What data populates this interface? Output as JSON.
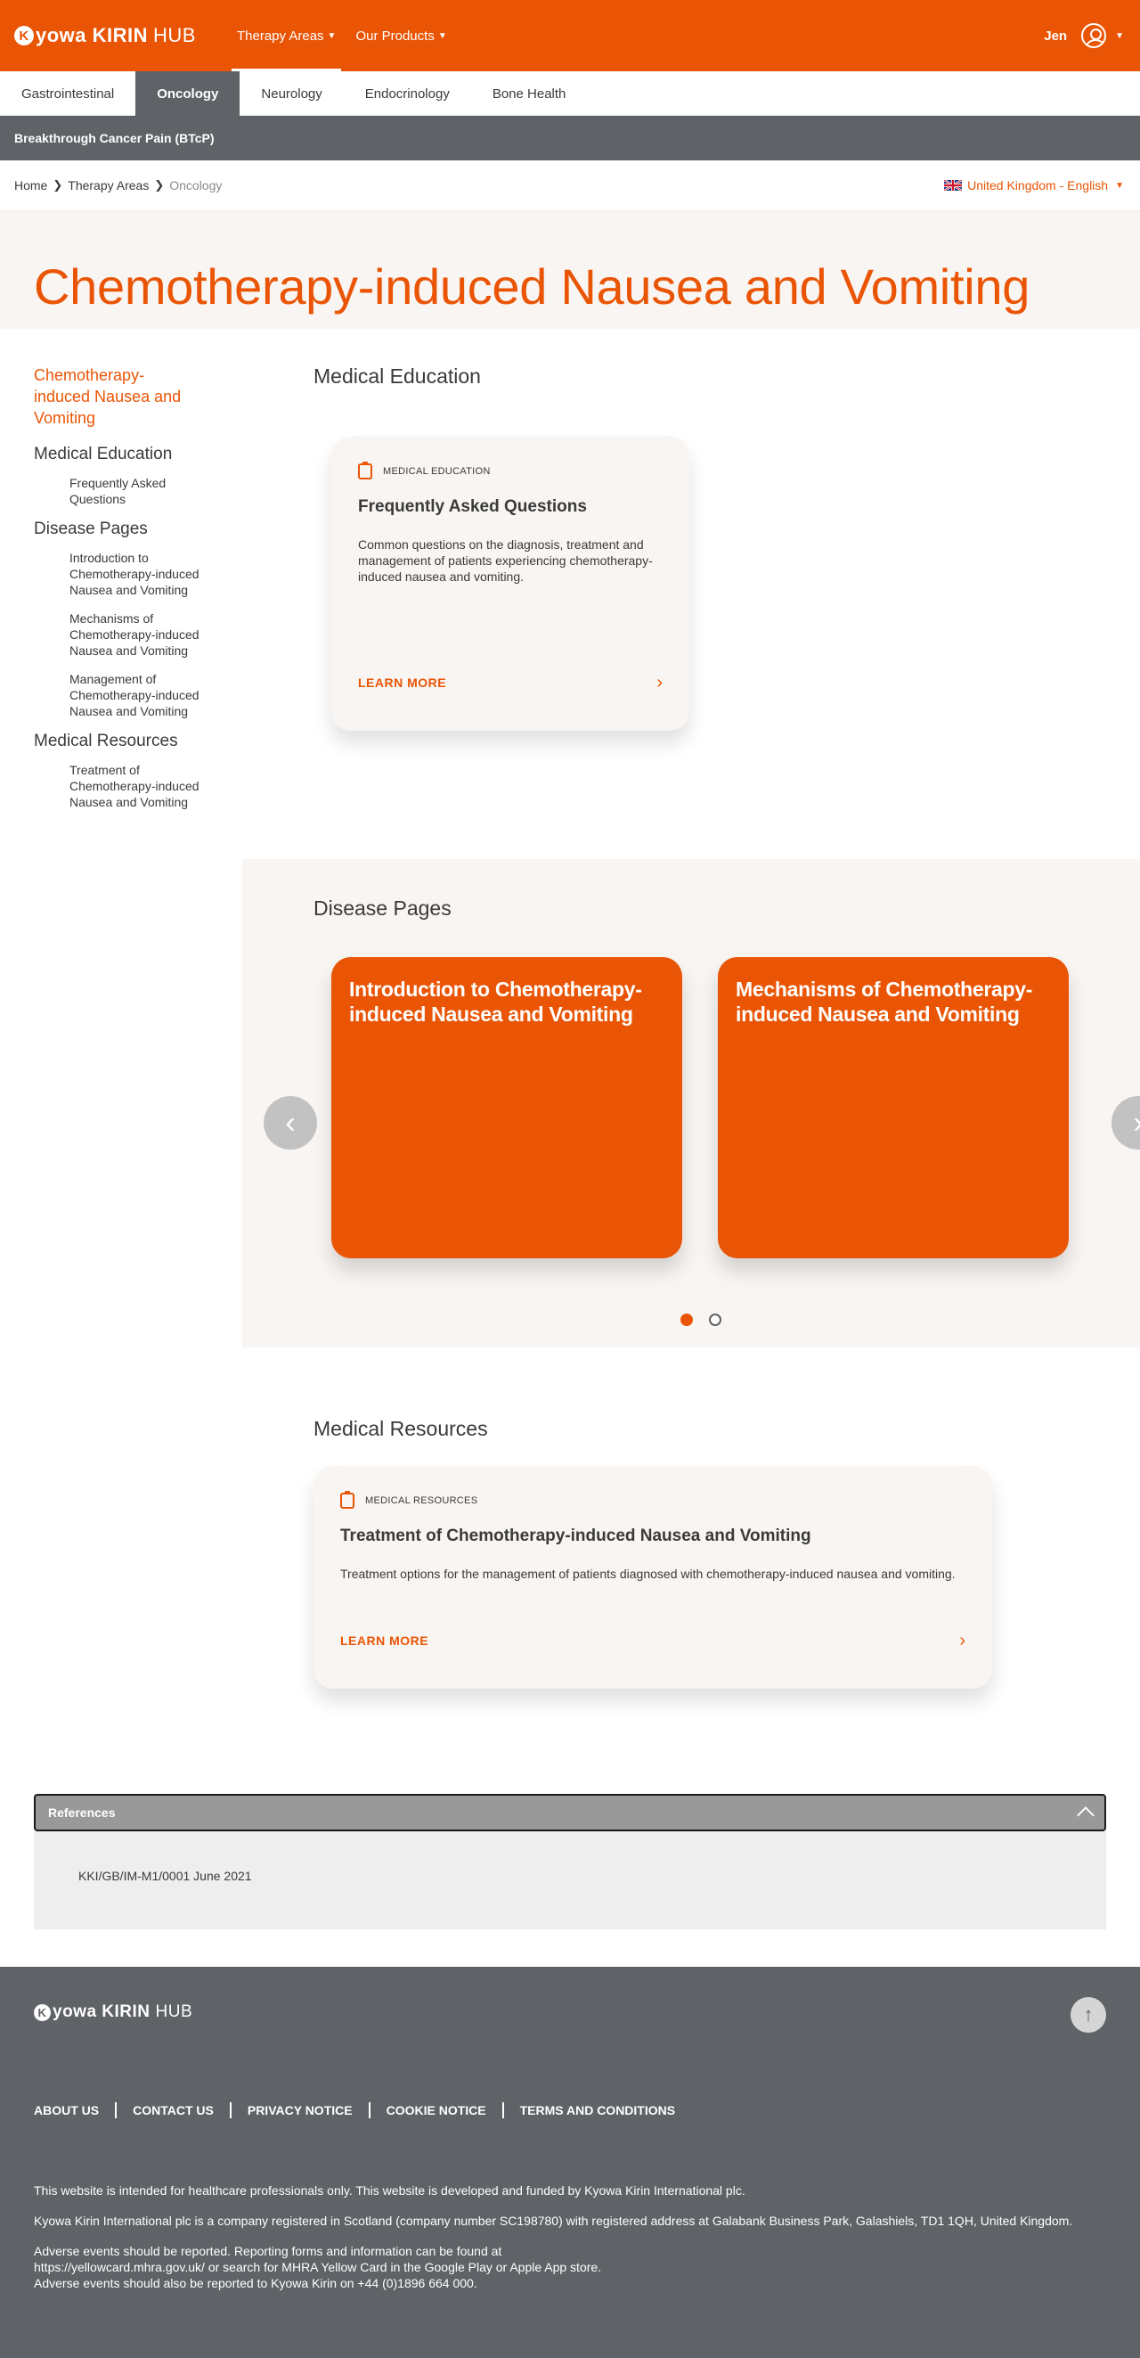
{
  "header": {
    "logo_mark": "K",
    "logo_text": "yowa KIRIN",
    "logo_hub": "HUB",
    "nav": [
      {
        "label": "Therapy Areas"
      },
      {
        "label": "Our Products"
      }
    ],
    "user_name": "Jen"
  },
  "subnav": {
    "tabs": [
      {
        "label": "Gastrointestinal"
      },
      {
        "label": "Oncology"
      },
      {
        "label": "Neurology"
      },
      {
        "label": "Endocrinology"
      },
      {
        "label": "Bone Health"
      }
    ],
    "active_tab": "Oncology",
    "secondary": "Breakthrough Cancer Pain (BTcP)"
  },
  "breadcrumb": {
    "items": [
      "Home",
      "Therapy Areas",
      "Oncology"
    ],
    "locale": "United Kingdom - English"
  },
  "hero": {
    "title": "Chemotherapy-induced Nausea and Vomiting"
  },
  "sidebar": {
    "title": "Chemotherapy-induced Nausea and Vomiting",
    "groups": [
      {
        "heading": "Medical Education",
        "items": [
          "Frequently Asked Questions"
        ]
      },
      {
        "heading": "Disease Pages",
        "items": [
          "Introduction to Chemotherapy-induced Nausea and Vomiting",
          "Mechanisms of Chemotherapy-induced Nausea and Vomiting",
          "Management of Chemotherapy-induced Nausea and Vomiting"
        ]
      },
      {
        "heading": "Medical Resources",
        "items": [
          "Treatment of Chemotherapy-induced Nausea and Vomiting"
        ]
      }
    ]
  },
  "medical_education": {
    "heading": "Medical Education",
    "card": {
      "tag": "MEDICAL EDUCATION",
      "title": "Frequently Asked Questions",
      "description": "Common questions on the diagnosis, treatment and management of patients experiencing chemotherapy-induced nausea and vomiting.",
      "cta": "LEARN MORE"
    }
  },
  "disease_pages": {
    "heading": "Disease Pages",
    "slides": [
      {
        "title": "Introduction to Chemotherapy-induced Nausea and Vomiting"
      },
      {
        "title": "Mechanisms of Chemotherapy-induced Nausea and Vomiting"
      }
    ],
    "pagination": {
      "count": 2,
      "active_index": 0
    }
  },
  "medical_resources": {
    "heading": "Medical Resources",
    "card": {
      "tag": "MEDICAL RESOURCES",
      "title": "Treatment of Chemotherapy-induced Nausea and Vomiting",
      "description": "Treatment options for the management of patients diagnosed with chemotherapy-induced nausea and vomiting.",
      "cta": "LEARN MORE"
    }
  },
  "references": {
    "heading": "References",
    "body": "KKI/GB/IM-M1/0001 June 2021"
  },
  "footer": {
    "links": [
      "ABOUT US",
      "CONTACT US",
      "PRIVACY NOTICE",
      "COOKIE NOTICE",
      "TERMS AND CONDITIONS"
    ],
    "text1": "This website is intended for healthcare professionals only. This website is developed and funded by Kyowa Kirin International plc.",
    "text2": "Kyowa Kirin International plc is a company registered in Scotland (company number SC198780) with registered address at Galabank Business Park, Galashiels, TD1 1QH, United Kingdom.",
    "text3_line1": "Adverse events should be reported. Reporting forms and information can be found at",
    "text3_line2": "https://yellowcard.mhra.gov.uk/ or search for MHRA Yellow Card in the Google Play or Apple App store.",
    "text3_line3": "Adverse events should also be reported to Kyowa Kirin on +44 (0)1896 664 000."
  },
  "colors": {
    "brand_orange": "#ea5505",
    "dark_grey": "#5f6266",
    "cream": "#f8f5f2"
  },
  "icons": {
    "user": "user-circle-icon",
    "clipboard": "clipboard-icon",
    "arrow_left": "chevron-left-icon",
    "arrow_right": "chevron-right-icon",
    "back_to_top": "arrow-up-icon",
    "flag": "uk-flag-icon"
  }
}
